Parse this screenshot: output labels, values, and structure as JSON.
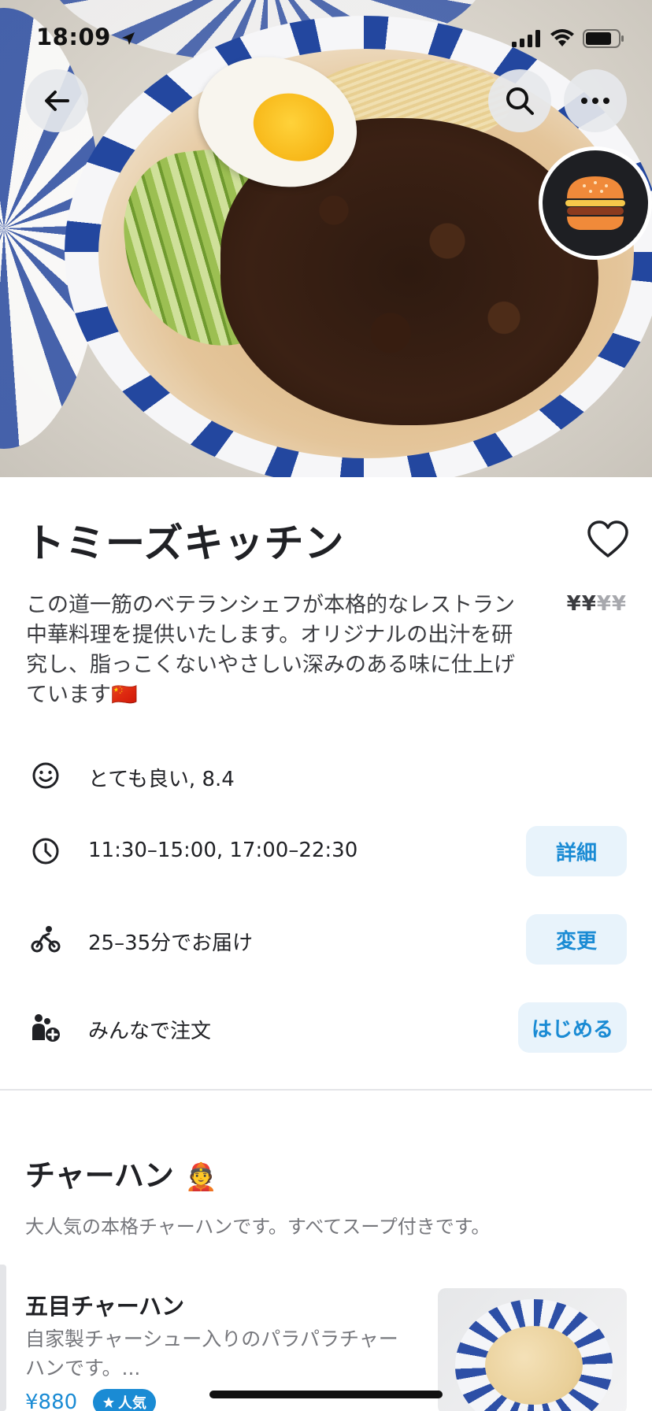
{
  "status_bar": {
    "time": "18:09"
  },
  "hero": {
    "back_icon": "arrow-left-icon",
    "search_icon": "search-icon",
    "more_icon": "more-horizontal-icon",
    "logo_icon": "hamburger-icon"
  },
  "restaurant": {
    "name": "トミーズキッチン",
    "description": "この道一筋のベテランシェフが本格的なレストラン中華料理を提供いたします。オリジナルの出汁を研究し、脂っこくないやさしい深みのある味に仕上げています",
    "description_emoji": "🇨🇳",
    "price_active": "¥¥",
    "price_inactive": "¥¥"
  },
  "info_rows": [
    {
      "icon": "smiley-icon",
      "text": "とても良い, 8.4"
    },
    {
      "icon": "clock-icon",
      "text": "11:30–15:00, 17:00–22:30",
      "button": "詳細"
    },
    {
      "icon": "bike-icon",
      "text": "25–35分でお届け",
      "button": "変更"
    },
    {
      "icon": "group-add-icon",
      "text": "みんなで注文",
      "button": "はじめる"
    }
  ],
  "section": {
    "title": "チャーハン",
    "title_emoji": "👲",
    "subtitle": "大人気の本格チャーハンです。すべてスープ付きです。"
  },
  "items": [
    {
      "name": "五目チャーハン",
      "description": "自家製チャーシュー入りのパラパラチャーハンです。...",
      "price": "¥880",
      "badge": "人気"
    }
  ],
  "colors": {
    "accent": "#1a8bd4",
    "pill_bg": "#e8f3fb",
    "text": "#202125",
    "muted": "#76777c"
  }
}
